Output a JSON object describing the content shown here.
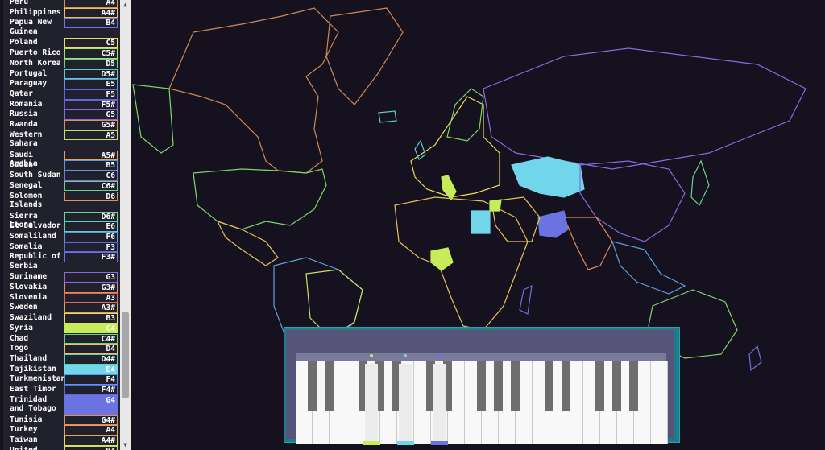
{
  "colors": {
    "background": "#15111f",
    "sidebar": "#21212d",
    "piano_frame": "#1e7d8a",
    "piano_body": "#565478",
    "active_green": "#c6ec5a",
    "active_cyan": "#72d6ea",
    "active_blue": "#6a73e0"
  },
  "sidebar": {
    "rows": [
      {
        "country": "Peru",
        "note": "A4",
        "color": "#e08e5a",
        "highlight": false
      },
      {
        "country": "Philippines",
        "note": "A4#",
        "color": "#e8c35a",
        "highlight": false
      },
      {
        "country": "Papua New Guinea",
        "note": "B4",
        "color": "#6a73e0",
        "highlight": false
      },
      {
        "country": "Poland",
        "note": "C5",
        "color": "#e8de5a",
        "highlight": false
      },
      {
        "country": "Puerto Rico",
        "note": "C5#",
        "color": "#a7e06a",
        "highlight": false
      },
      {
        "country": "North Korea",
        "note": "D5",
        "color": "#6ad48a",
        "highlight": false
      },
      {
        "country": "Portugal",
        "note": "D5#",
        "color": "#5ad0c8",
        "highlight": false
      },
      {
        "country": "Paraguay",
        "note": "E5",
        "color": "#5a9ae0",
        "highlight": false
      },
      {
        "country": "Qatar",
        "note": "F5",
        "color": "#5a6ae0",
        "highlight": false
      },
      {
        "country": "Romania",
        "note": "F5#",
        "color": "#7a5ae0",
        "highlight": false
      },
      {
        "country": "Russia",
        "note": "G5",
        "color": "#8a6ae0",
        "highlight": false
      },
      {
        "country": "Rwanda",
        "note": "G5#",
        "color": "#e08e5a",
        "highlight": false
      },
      {
        "country": "Western Sahara",
        "note": "A5",
        "color": "#c4e06a",
        "highlight": false
      },
      {
        "country": "Saudi Arabia",
        "note": "A5#",
        "color": "#e0a45a",
        "highlight": false
      },
      {
        "country": "Sudan",
        "note": "B5",
        "color": "#5a9ae0",
        "highlight": false
      },
      {
        "country": "South Sudan",
        "note": "C6",
        "color": "#8a6ae0",
        "highlight": false
      },
      {
        "country": "Senegal",
        "note": "C6#",
        "color": "#6ad48a",
        "highlight": false
      },
      {
        "country": "Solomon Islands",
        "note": "D6",
        "color": "#e08e5a",
        "highlight": false
      },
      {
        "country": "Sierra Leone",
        "note": "D6#",
        "color": "#6ad48a",
        "highlight": false
      },
      {
        "country": "El Salvador",
        "note": "E6",
        "color": "#5ad0c8",
        "highlight": false
      },
      {
        "country": "Somaliland",
        "note": "F6",
        "color": "#5a9ae0",
        "highlight": false
      },
      {
        "country": "Somalia",
        "note": "F3",
        "color": "#5a6ae0",
        "highlight": false
      },
      {
        "country": "Republic of Serbia",
        "note": "F3#",
        "color": "#6a73e0",
        "highlight": false
      },
      {
        "country": "Suriname",
        "note": "G3",
        "color": "#8a6ae0",
        "highlight": false
      },
      {
        "country": "Slovakia",
        "note": "G3#",
        "color": "#e08e5a",
        "highlight": false
      },
      {
        "country": "Slovenia",
        "note": "A3",
        "color": "#e06a5a",
        "highlight": false
      },
      {
        "country": "Sweden",
        "note": "A3#",
        "color": "#e0a45a",
        "highlight": false
      },
      {
        "country": "Swaziland",
        "note": "B3",
        "color": "#e8de5a",
        "highlight": false
      },
      {
        "country": "Syria",
        "note": "C4",
        "color": "#c6ec5a",
        "highlight": true
      },
      {
        "country": "Chad",
        "note": "C4#",
        "color": "#6ad48a",
        "highlight": false
      },
      {
        "country": "Togo",
        "note": "D4",
        "color": "#e8c35a",
        "highlight": false
      },
      {
        "country": "Thailand",
        "note": "D4#",
        "color": "#5ad0c8",
        "highlight": false
      },
      {
        "country": "Tajikistan",
        "note": "E4",
        "color": "#72d6ea",
        "highlight": true
      },
      {
        "country": "Turkmenistan",
        "note": "F4",
        "color": "#5a9ae0",
        "highlight": false
      },
      {
        "country": "East Timor",
        "note": "F4#",
        "color": "#5a6ae0",
        "highlight": false
      },
      {
        "country": "Trinidad and Tobago",
        "note": "G4",
        "color": "#6a73e0",
        "highlight": true
      },
      {
        "country": "Tunisia",
        "note": "G4#",
        "color": "#e08e5a",
        "highlight": false
      },
      {
        "country": "Turkey",
        "note": "A4",
        "color": "#e0a45a",
        "highlight": false
      },
      {
        "country": "Taiwan",
        "note": "A4#",
        "color": "#e8de5a",
        "highlight": false
      },
      {
        "country": "United",
        "note": "B4",
        "color": "#c4e06a",
        "highlight": false
      }
    ]
  },
  "scrollbar": {
    "up_arrow": "▲",
    "down_arrow": "▼"
  },
  "piano": {
    "white_key_count": 22,
    "black_key_pattern": [
      1,
      1,
      0,
      1,
      1,
      1,
      0
    ],
    "active": [
      {
        "label": "C4",
        "color": "#c6ec5a"
      },
      {
        "label": "E4",
        "color": "#72d6ea"
      },
      {
        "label": "G4",
        "color": "#6a73e0"
      }
    ]
  }
}
